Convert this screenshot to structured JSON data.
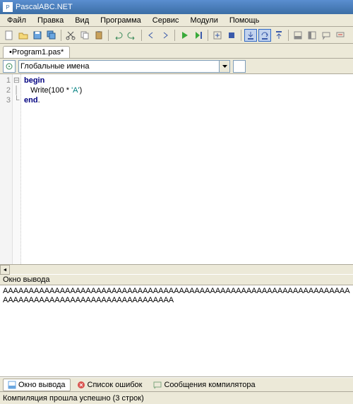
{
  "titlebar": {
    "title": "PascalABC.NET"
  },
  "menu": {
    "items": [
      "Файл",
      "Правка",
      "Вид",
      "Программа",
      "Сервис",
      "Модули",
      "Помощь"
    ]
  },
  "tabs": {
    "active": "•Program1.pas*"
  },
  "combo": {
    "label": "Глобальные имена"
  },
  "code": {
    "lines": [
      {
        "n": "1",
        "fold": "⊟",
        "indent": "",
        "kw": "begin",
        "rest": ""
      },
      {
        "n": "2",
        "fold": "",
        "indent": "   ",
        "fn": "Write",
        "open": "(",
        "num": "100",
        "op": " * ",
        "str": "'A'",
        "close": ")"
      },
      {
        "n": "3",
        "fold": "",
        "indent": "",
        "kw": "end",
        "dot": "."
      }
    ]
  },
  "output": {
    "title": "Окно вывода",
    "text": "AAAAAAAAAAAAAAAAAAAAAAAAAAAAAAAAAAAAAAAAAAAAAAAAAAAAAAAAAAAAAAAAAAAAAAAAAAAAAAAAAAAAAAAAAAAAAAAAAAAA"
  },
  "bottom_tabs": {
    "items": [
      {
        "label": "Окно вывода",
        "color": "#6aa6e0",
        "active": true
      },
      {
        "label": "Список ошибок",
        "color": "#d9534f",
        "active": false
      },
      {
        "label": "Сообщения компилятора",
        "color": "#7fa87f",
        "active": false
      }
    ]
  },
  "status": {
    "text": "Компиляция прошла успешно (3 строк)"
  },
  "icons": {
    "new": "#fff",
    "open": "#f5d97a",
    "save": "#6aa6e0",
    "saveall": "#6aa6e0",
    "cut": "#888",
    "copy": "#888",
    "paste": "#c9a15a",
    "undo": "#4a8",
    "redo": "#4a8",
    "run": "#3a3",
    "stop": "#33a",
    "step": "#33a",
    "break": "#33a"
  }
}
